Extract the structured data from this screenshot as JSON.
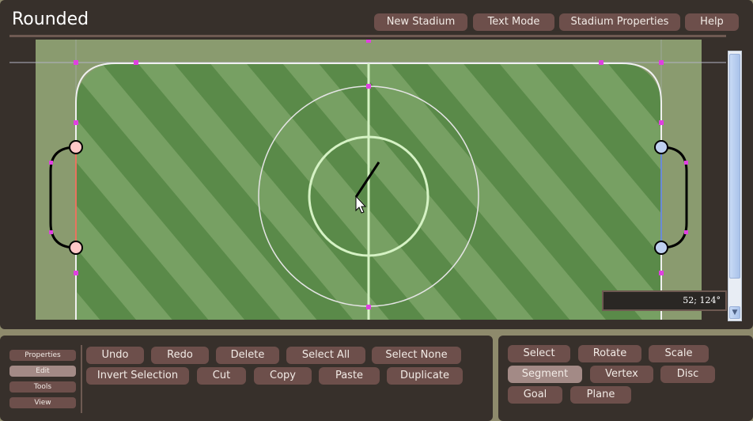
{
  "app": {
    "title": "Rounded"
  },
  "header_buttons": {
    "new_stadium": "New Stadium",
    "text_mode": "Text Mode",
    "stadium_properties": "Stadium Properties",
    "help": "Help"
  },
  "coords_readout": "52; 124°",
  "side_tabs": {
    "properties": "Properties",
    "edit": "Edit",
    "tools": "Tools",
    "view": "View"
  },
  "edit_actions": {
    "undo": "Undo",
    "redo": "Redo",
    "delete": "Delete",
    "select_all": "Select All",
    "select_none": "Select None",
    "invert_selection": "Invert Selection",
    "cut": "Cut",
    "copy": "Copy",
    "paste": "Paste",
    "duplicate": "Duplicate"
  },
  "tools": {
    "select": "Select",
    "rotate": "Rotate",
    "scale": "Scale",
    "segment": "Segment",
    "vertex": "Vertex",
    "disc": "Disc",
    "goal": "Goal",
    "plane": "Plane"
  },
  "active_side_tab": "Edit",
  "active_tool": "Segment",
  "colors": {
    "panel_bg": "#37302b",
    "button_bg": "#6d4f4b",
    "button_active_bg": "#a38a86",
    "grass_dark": "#5a8a49",
    "grass_light": "#77a063",
    "red_goal_post": "#ffc8c8",
    "blue_goal_post": "#bfd1f0",
    "handle": "#e040e0"
  }
}
